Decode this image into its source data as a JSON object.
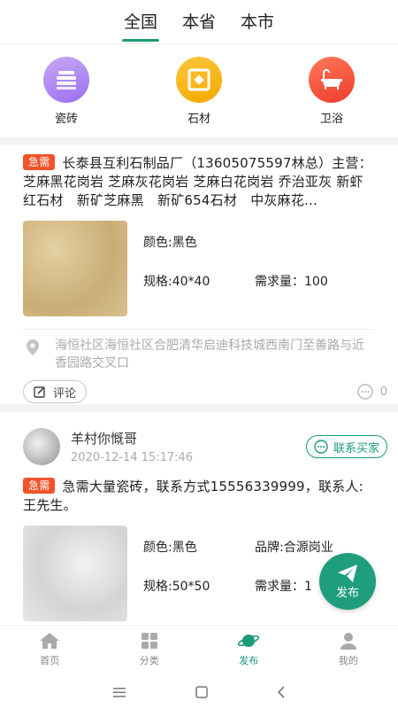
{
  "region_tabs": [
    {
      "label": "全国",
      "active": true
    },
    {
      "label": "本省",
      "active": false
    },
    {
      "label": "本市",
      "active": false
    }
  ],
  "categories": [
    {
      "label": "瓷砖",
      "icon": "tile-stack-icon",
      "color": "#a57ff2"
    },
    {
      "label": "石材",
      "icon": "stone-frame-icon",
      "color": "#f5b400"
    },
    {
      "label": "卫浴",
      "icon": "bathtub-icon",
      "color": "#ef4a33"
    }
  ],
  "posts": [
    {
      "tag": "急需",
      "text": "长泰县互利石制品厂（13605075597林总）主营：芝麻黑花岗岩 芝麻灰花岗岩 芝麻白花岗岩 乔治亚灰 新虾红石材　新矿芝麻黑　新矿654石材　中灰麻花...",
      "color": "颜色:黑色",
      "spec": "规格:40*40",
      "demand": "需求量：100",
      "location": "海恒社区海恒社区合肥清华启迪科技城西南门至善路与近香园路交叉口",
      "comment_label": "评论",
      "comment_count": "0"
    },
    {
      "author": "羊村你慨哥",
      "time": "2020-12-14 15:17:46",
      "contact_label": "联系买家",
      "tag": "急需",
      "text": "急需大量瓷砖，联系方式15556339999，联系人:王先生。",
      "color": "颜色:黑色",
      "brand": "品牌:合源岗业",
      "spec": "规格:50*50",
      "demand": "需求量：1"
    }
  ],
  "fab_label": "发布",
  "bottom_nav": [
    {
      "label": "首页",
      "icon": "home-icon",
      "active": false
    },
    {
      "label": "分类",
      "icon": "grid-icon",
      "active": false
    },
    {
      "label": "发布",
      "icon": "planet-icon",
      "active": true
    },
    {
      "label": "我的",
      "icon": "user-icon",
      "active": false
    }
  ],
  "accent_color": "#1a9a78",
  "urgent_color": "#f2532c"
}
